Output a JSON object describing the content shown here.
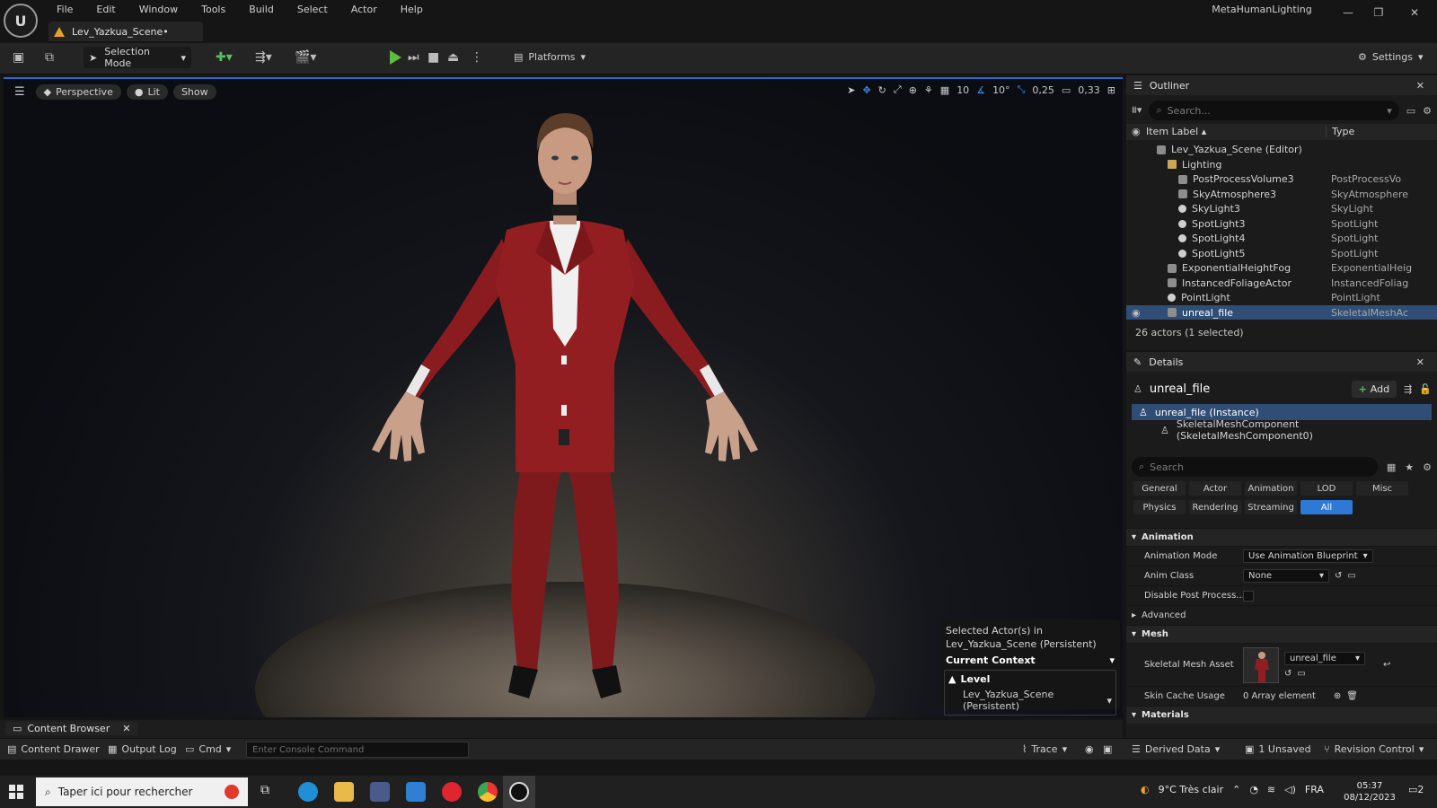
{
  "window": {
    "project_name": "MetaHumanLighting",
    "logo_text": "U",
    "document_tab": "Lev_Yazkua_Scene•",
    "menu": [
      "File",
      "Edit",
      "Window",
      "Tools",
      "Build",
      "Select",
      "Actor",
      "Help"
    ],
    "minimize": "—",
    "restore": "❐",
    "close": "✕"
  },
  "toolbar": {
    "selection_mode": "Selection Mode",
    "platforms": "Platforms",
    "settings": "Settings"
  },
  "viewport": {
    "perspective": "Perspective",
    "lit": "Lit",
    "show": "Show",
    "grid_snap": "10",
    "rotation_snap": "10°",
    "scale_snap": "0,25",
    "camera_speed": "0,33"
  },
  "selection_overlay": {
    "line1": "Selected Actor(s) in",
    "line2": "Lev_Yazkua_Scene (Persistent)",
    "context_label": "Current Context",
    "level_label": "Level",
    "level_value": "Lev_Yazkua_Scene (Persistent)"
  },
  "outliner": {
    "tab": "Outliner",
    "search_placeholder": "Search...",
    "col_label": "Item Label ▴",
    "col_type": "Type",
    "rows": [
      {
        "label": "Lev_Yazkua_Scene (Editor)",
        "type": "",
        "indent": 1,
        "icon": "level-icon"
      },
      {
        "label": "Lighting",
        "type": "",
        "indent": 2,
        "icon": "folder-icon"
      },
      {
        "label": "PostProcessVolume3",
        "type": "PostProcessVo",
        "indent": 3,
        "icon": "volume-icon"
      },
      {
        "label": "SkyAtmosphere3",
        "type": "SkyAtmosphere",
        "indent": 3,
        "icon": "atmosphere-icon"
      },
      {
        "label": "SkyLight3",
        "type": "SkyLight",
        "indent": 3,
        "icon": "skylight-icon"
      },
      {
        "label": "SpotLight3",
        "type": "SpotLight",
        "indent": 3,
        "icon": "spotlight-icon"
      },
      {
        "label": "SpotLight4",
        "type": "SpotLight",
        "indent": 3,
        "icon": "spotlight-icon"
      },
      {
        "label": "SpotLight5",
        "type": "SpotLight",
        "indent": 3,
        "icon": "spotlight-icon"
      },
      {
        "label": "ExponentialHeightFog",
        "type": "ExponentialHeig",
        "indent": 2,
        "icon": "fog-icon"
      },
      {
        "label": "InstancedFoliageActor",
        "type": "InstancedFoliag",
        "indent": 2,
        "icon": "foliage-icon"
      },
      {
        "label": "PointLight",
        "type": "PointLight",
        "indent": 2,
        "icon": "pointlight-icon"
      },
      {
        "label": "unreal_file",
        "type": "SkeletalMeshAc",
        "indent": 2,
        "icon": "skeletal-mesh-icon",
        "selected": true
      }
    ],
    "footer": "26 actors (1 selected)"
  },
  "details": {
    "tab": "Details",
    "actor_name": "unreal_file",
    "add_label": "Add",
    "instance_row": "unreal_file (Instance)",
    "component_row": "SkeletalMeshComponent (SkeletalMeshComponent0)",
    "search_placeholder": "Search",
    "tabs_row1": [
      "General",
      "Actor",
      "Animation",
      "LOD",
      "Misc"
    ],
    "tabs_row2": [
      "Physics",
      "Rendering",
      "Streaming",
      "All"
    ],
    "active_tab": "All",
    "sections": {
      "animation": "Animation",
      "animation_mode_label": "Animation Mode",
      "animation_mode_value": "Use Animation Blueprint",
      "anim_class_label": "Anim Class",
      "anim_class_value": "None",
      "disable_post_label": "Disable Post Process...",
      "advanced": "Advanced",
      "mesh": "Mesh",
      "skeletal_mesh_label": "Skeletal Mesh Asset",
      "skeletal_mesh_value": "unreal_file",
      "skin_cache_label": "Skin Cache Usage",
      "skin_cache_value": "0 Array element",
      "materials": "Materials"
    }
  },
  "bottom": {
    "content_browser_tab": "Content Browser",
    "content_drawer": "Content Drawer",
    "output_log": "Output Log",
    "cmd": "Cmd",
    "console_placeholder": "Enter Console Command",
    "trace": "Trace",
    "derived_data": "Derived Data",
    "unsaved": "1 Unsaved",
    "revision_control": "Revision Control"
  },
  "taskbar": {
    "search_text": "Taper ici pour rechercher",
    "weather": "9°C  Très clair",
    "language": "FRA",
    "time": "05:37",
    "date": "08/12/2023",
    "notifications": "2"
  },
  "colors": {
    "accent": "#2e78d6",
    "selection": "#2f4d75",
    "play_green": "#5dbb3f",
    "suit_red": "#8c1c1f"
  }
}
